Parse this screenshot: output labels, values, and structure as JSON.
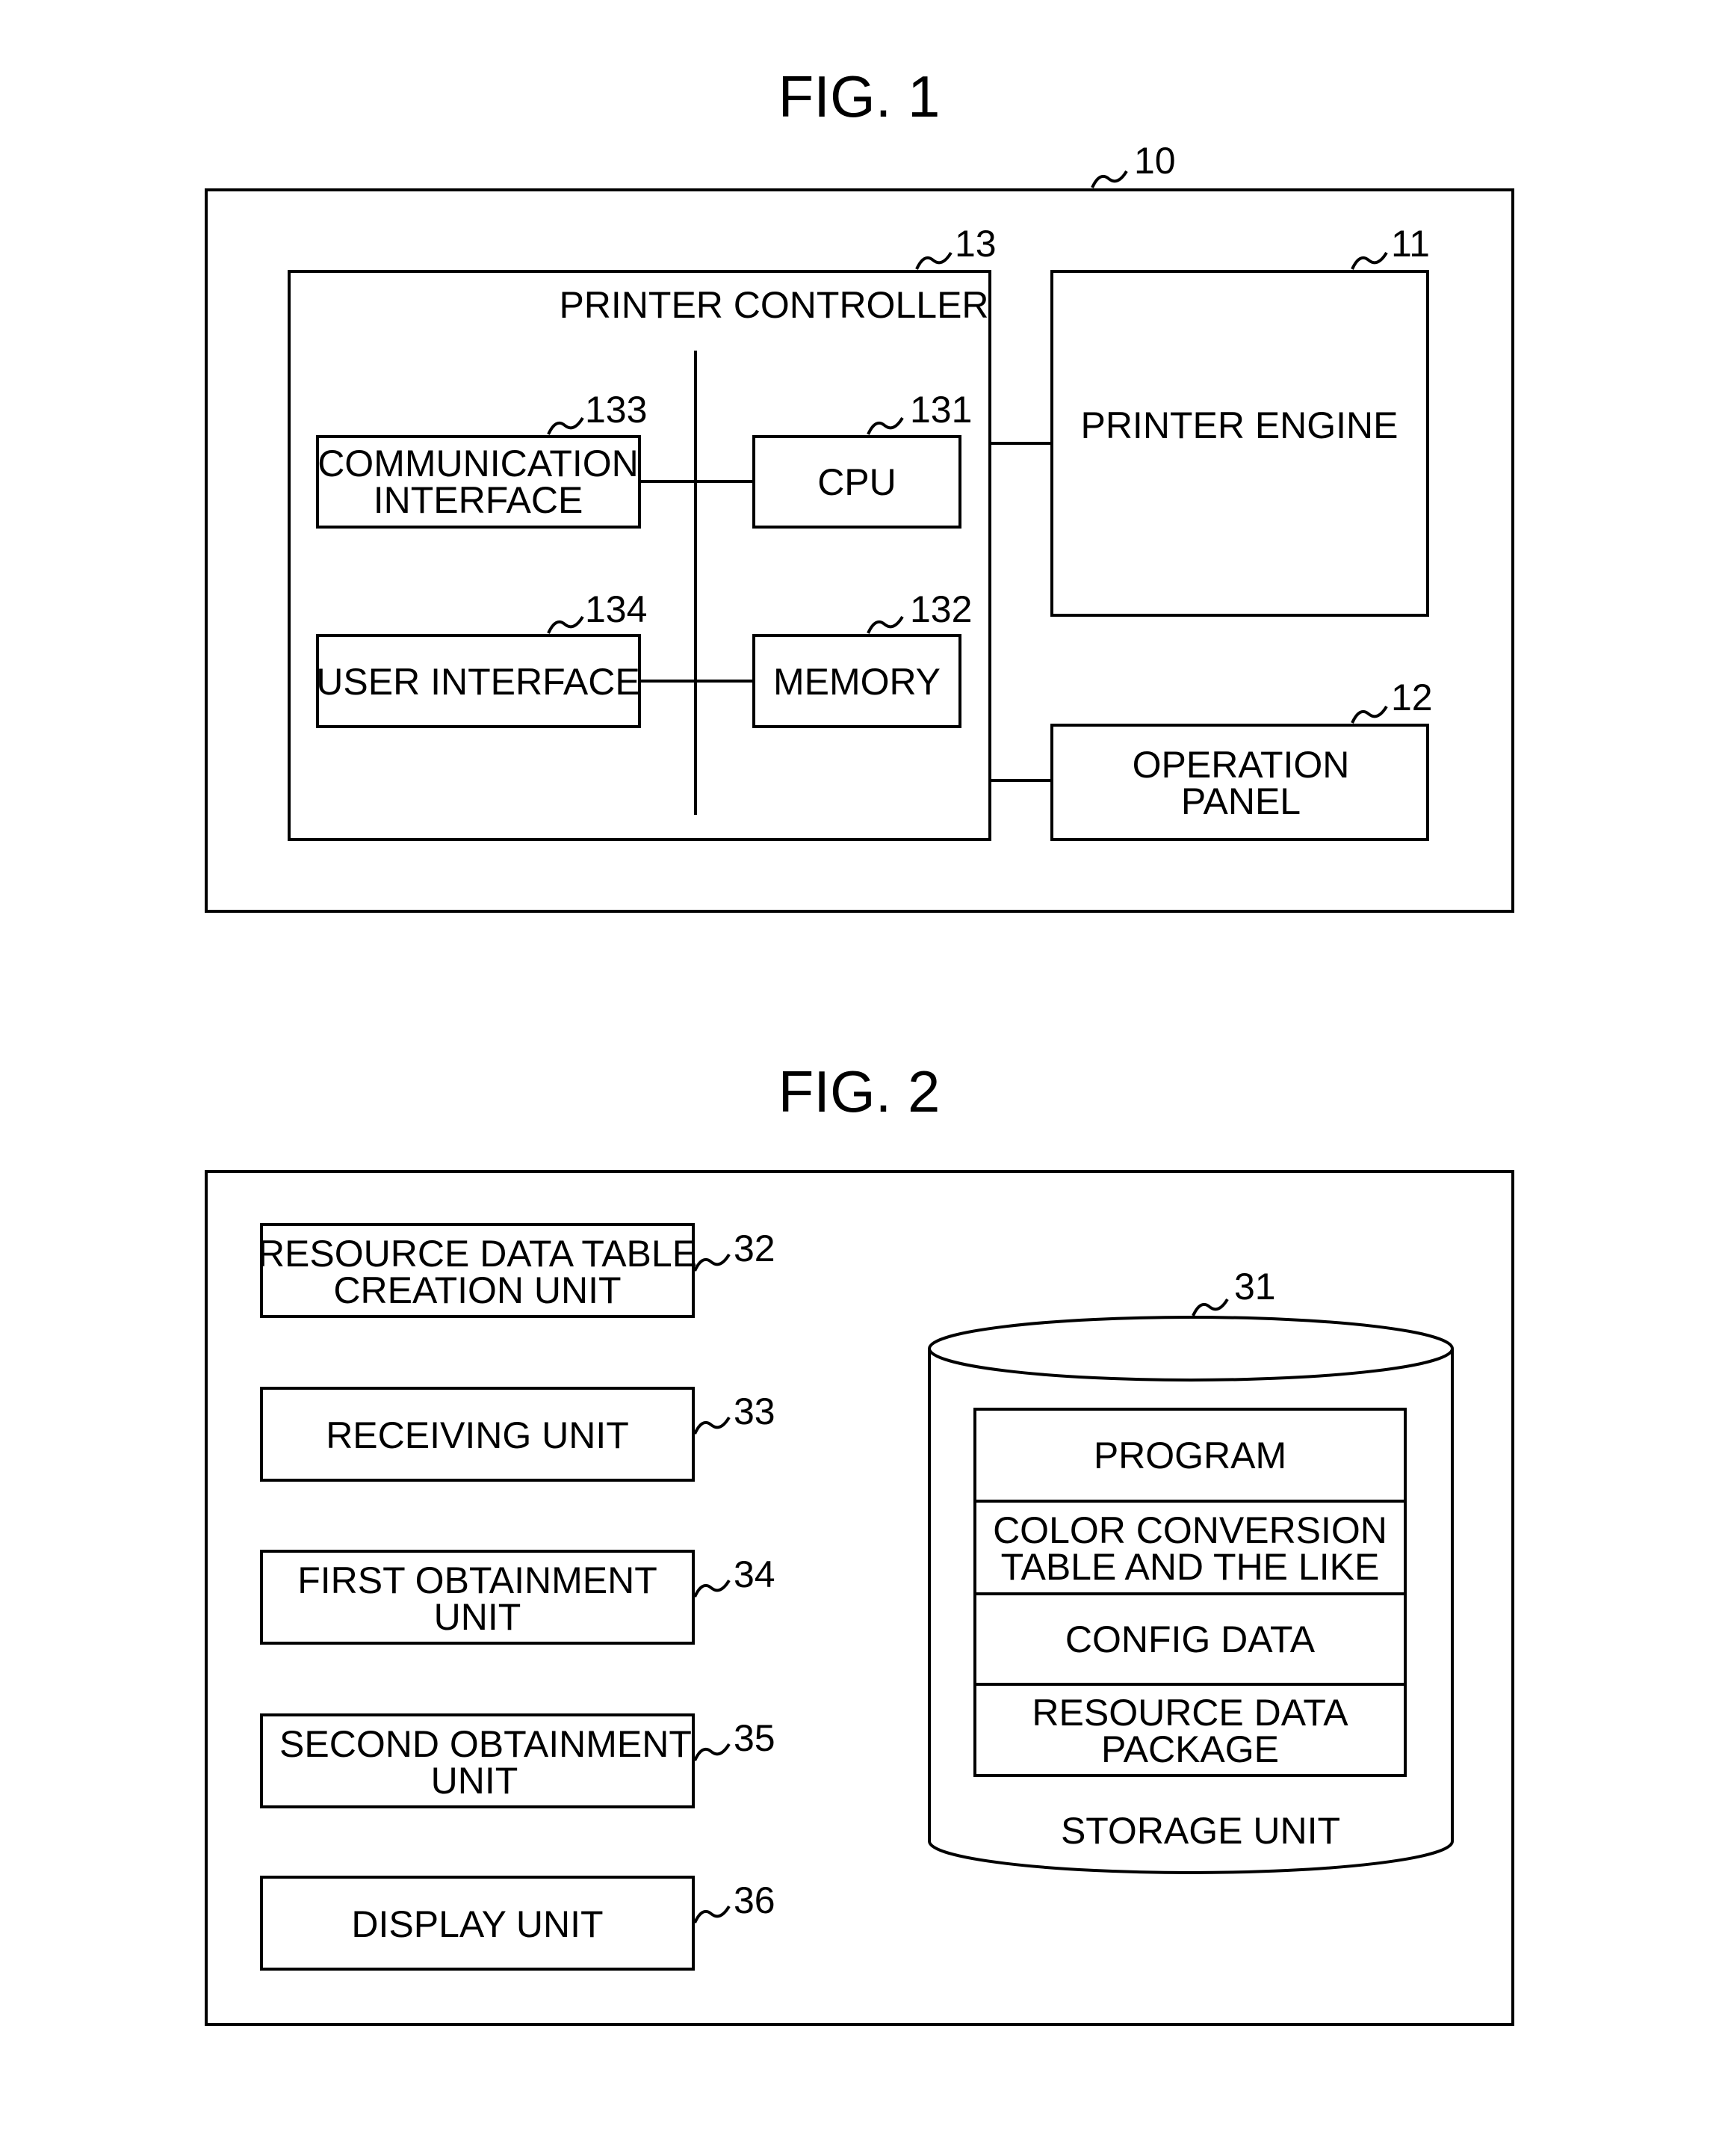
{
  "fig1": {
    "title": "FIG. 1",
    "device": {
      "ref": "10"
    },
    "printer_controller": {
      "ref": "13",
      "label": "PRINTER CONTROLLER"
    },
    "cpu": {
      "ref": "131",
      "label": "CPU"
    },
    "memory": {
      "ref": "132",
      "label": "MEMORY"
    },
    "communication_interface": {
      "ref": "133",
      "lines": [
        "COMMUNICATION",
        "INTERFACE"
      ]
    },
    "user_interface": {
      "ref": "134",
      "label": "USER INTERFACE"
    },
    "printer_engine": {
      "ref": "11",
      "label": "PRINTER ENGINE"
    },
    "operation_panel": {
      "ref": "12",
      "lines": [
        "OPERATION",
        "PANEL"
      ]
    }
  },
  "fig2": {
    "title": "FIG. 2",
    "units": [
      {
        "ref": "32",
        "lines": [
          "RESOURCE DATA TABLE",
          "CREATION UNIT"
        ]
      },
      {
        "ref": "33",
        "lines": [
          "RECEIVING UNIT"
        ]
      },
      {
        "ref": "34",
        "lines": [
          "FIRST OBTAINMENT",
          "UNIT"
        ]
      },
      {
        "ref": "35",
        "lines": [
          "SECOND OBTAINMENT",
          "UNIT"
        ]
      },
      {
        "ref": "36",
        "lines": [
          "DISPLAY UNIT"
        ]
      }
    ],
    "storage": {
      "ref": "31",
      "label": "STORAGE UNIT",
      "contents": [
        {
          "lines": [
            "PROGRAM"
          ]
        },
        {
          "lines": [
            "COLOR CONVERSION",
            "TABLE AND THE LIKE"
          ]
        },
        {
          "lines": [
            "CONFIG DATA"
          ]
        },
        {
          "lines": [
            "RESOURCE DATA",
            "PACKAGE"
          ]
        }
      ]
    }
  }
}
